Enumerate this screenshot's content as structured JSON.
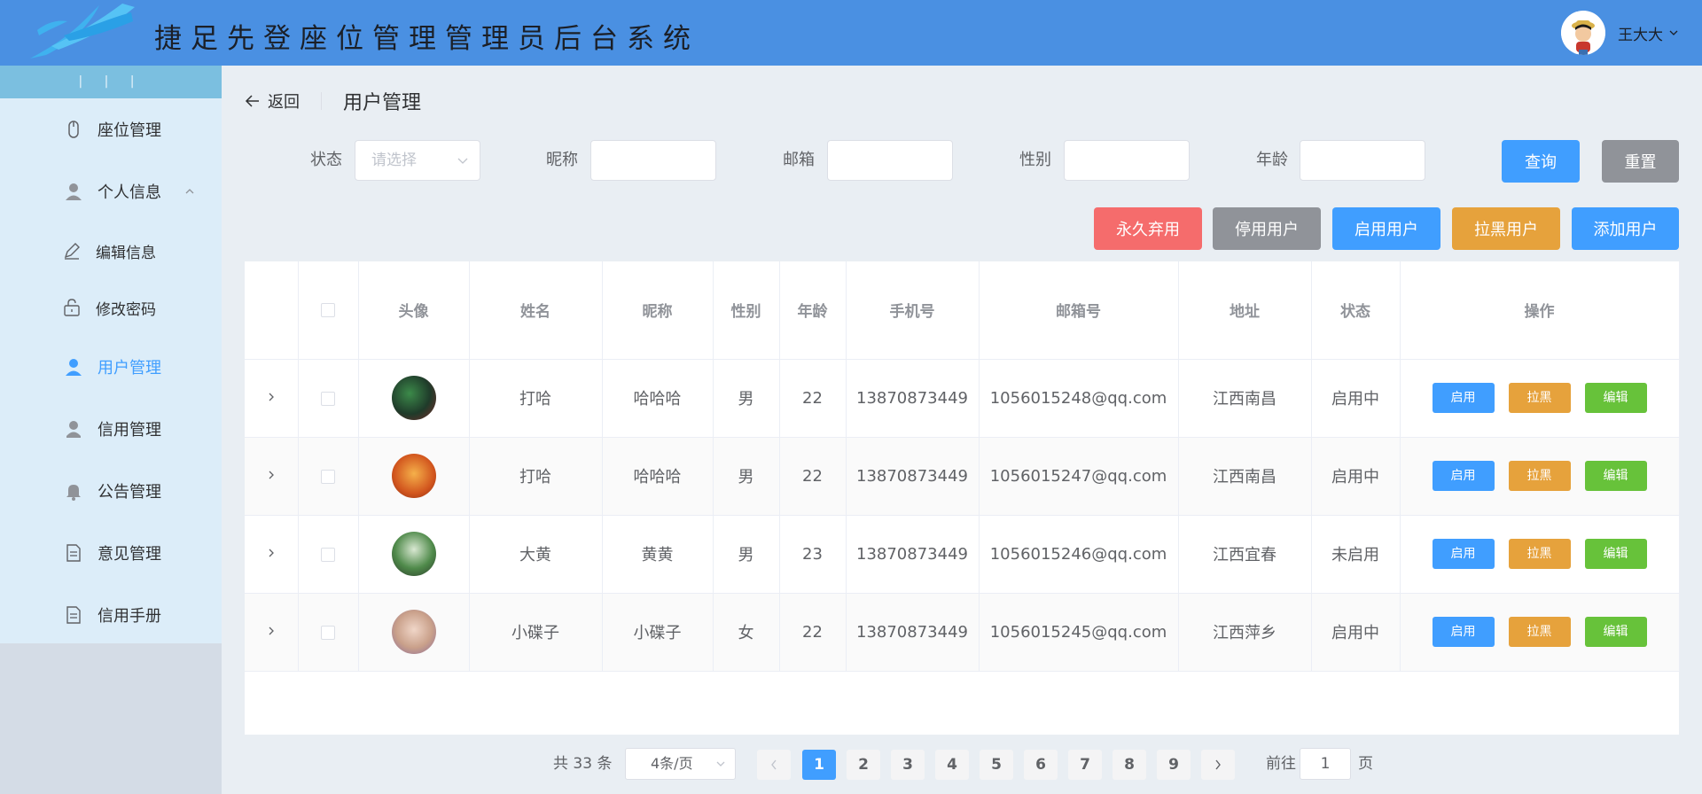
{
  "header": {
    "title": "捷足先登座位管理管理员后台系统",
    "user_name": "王大大"
  },
  "sidebar": {
    "collapse_label": "| | |",
    "items": [
      {
        "label": "座位管理",
        "icon": "mouse-icon"
      },
      {
        "label": "个人信息",
        "icon": "user-icon",
        "expanded": true
      },
      {
        "label": "编辑信息",
        "icon": "edit-icon",
        "sub": true
      },
      {
        "label": "修改密码",
        "icon": "unlock-icon",
        "sub": true
      },
      {
        "label": "用户管理",
        "icon": "user-icon",
        "active": true
      },
      {
        "label": "信用管理",
        "icon": "user-solid-icon"
      },
      {
        "label": "公告管理",
        "icon": "bell-icon"
      },
      {
        "label": "意见管理",
        "icon": "document-icon"
      },
      {
        "label": "信用手册",
        "icon": "document-icon"
      }
    ]
  },
  "page": {
    "back_label": "返回",
    "title": "用户管理"
  },
  "filters": {
    "status_label": "状态",
    "status_placeholder": "请选择",
    "nickname_label": "昵称",
    "email_label": "邮箱",
    "gender_label": "性别",
    "age_label": "年龄",
    "query_label": "查询",
    "reset_label": "重置"
  },
  "actions": {
    "discard_label": "永久弃用",
    "disable_label": "停用用户",
    "enable_label": "启用用户",
    "blacklist_label": "拉黑用户",
    "add_label": "添加用户"
  },
  "table": {
    "headers": {
      "avatar": "头像",
      "name": "姓名",
      "nickname": "昵称",
      "gender": "性别",
      "age": "年龄",
      "phone": "手机号",
      "email": "邮箱号",
      "address": "地址",
      "status": "状态",
      "ops": "操作"
    },
    "op_labels": {
      "enable": "启用",
      "blacklist": "拉黑",
      "edit": "编辑"
    },
    "rows": [
      {
        "name": "打哈",
        "nickname": "哈哈哈",
        "gender": "男",
        "age": "22",
        "phone": "13870873449",
        "email": "1056015248@qq.com",
        "address": "江西南昌",
        "status": "启用中",
        "avatar_color": "#2e6b3a"
      },
      {
        "name": "打哈",
        "nickname": "哈哈哈",
        "gender": "男",
        "age": "22",
        "phone": "13870873449",
        "email": "1056015247@qq.com",
        "address": "江西南昌",
        "status": "启用中",
        "avatar_color": "#e0762a"
      },
      {
        "name": "大黄",
        "nickname": "黄黄",
        "gender": "男",
        "age": "23",
        "phone": "13870873449",
        "email": "1056015246@qq.com",
        "address": "江西宜春",
        "status": "未启用",
        "avatar_color": "#4f8a4a"
      },
      {
        "name": "小碟子",
        "nickname": "小碟子",
        "gender": "女",
        "age": "22",
        "phone": "13870873449",
        "email": "1056015245@qq.com",
        "address": "江西萍乡",
        "status": "启用中",
        "avatar_color": "#c9a08a"
      }
    ]
  },
  "pagination": {
    "total_text": "共 33 条",
    "page_size": "4条/页",
    "pages": [
      "1",
      "2",
      "3",
      "4",
      "5",
      "6",
      "7",
      "8",
      "9"
    ],
    "current": "1",
    "goto_label": "前往",
    "goto_value": "1",
    "page_suffix": "页"
  },
  "colors": {
    "header": "#4a90e2",
    "primary": "#409eff",
    "info": "#909399",
    "danger": "#f56c6c",
    "warning": "#e6a23c",
    "success": "#67c23a"
  }
}
